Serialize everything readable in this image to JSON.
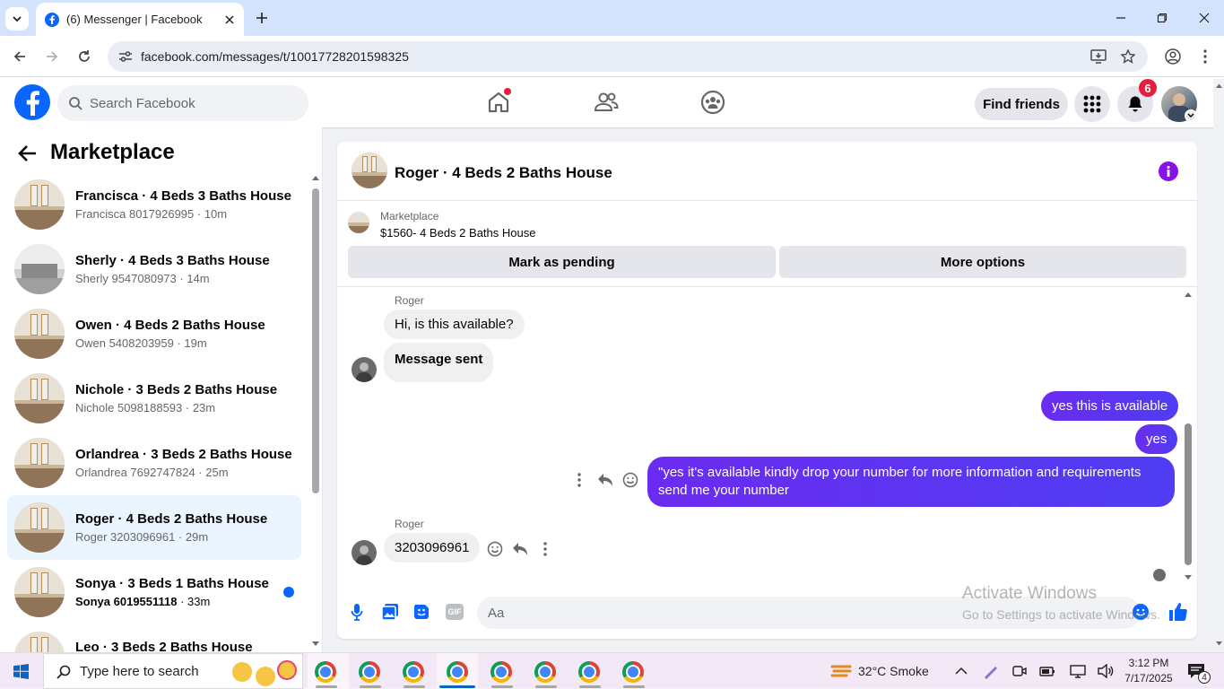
{
  "browser": {
    "tab_title": "(6) Messenger | Facebook",
    "url": "facebook.com/messages/t/10017728201598325"
  },
  "header": {
    "search_placeholder": "Search Facebook",
    "find_friends": "Find friends",
    "notification_count": "6",
    "brand_color": "#0866ff"
  },
  "left_panel": {
    "title": "Marketplace",
    "conversations": [
      {
        "name": "Francisca · 4 Beds 3 Baths House",
        "sub": "Francisca 8017926995 · 10m",
        "active": false,
        "unread": false
      },
      {
        "name": "Sherly · 4 Beds 3 Baths House",
        "sub": "Sherly 9547080973 · 14m",
        "active": false,
        "unread": false
      },
      {
        "name": "Owen · 4 Beds 2 Baths House",
        "sub": "Owen 5408203959 · 19m",
        "active": false,
        "unread": false
      },
      {
        "name": "Nichole · 3 Beds 2 Baths House",
        "sub": "Nichole 5098188593 · 23m",
        "active": false,
        "unread": false
      },
      {
        "name": "Orlandrea · 3 Beds 2 Baths House",
        "sub": "Orlandrea 7692747824 · 25m",
        "active": false,
        "unread": false
      },
      {
        "name": "Roger · 4 Beds 2 Baths House",
        "sub": "Roger 3203096961 · 29m",
        "active": true,
        "unread": false
      },
      {
        "name": "Sonya · 3 Beds 1 Baths House",
        "sub_bold": "Sonya 6019551118",
        "sub_time": " · 33m",
        "active": false,
        "unread": true
      },
      {
        "name": "Leo · 3 Beds 2 Baths House",
        "sub": "",
        "active": false,
        "unread": false
      }
    ]
  },
  "chat": {
    "title": "Roger · 4 Beds 2 Baths House",
    "listing_source": "Marketplace",
    "listing_price": "$1560- 4 Beds 2 Baths House",
    "mark_pending": "Mark as pending",
    "more_options": "More options",
    "messages": {
      "sender1": "Roger",
      "in1": "Hi, is this available?",
      "in2": "Message sent",
      "out1": "yes this is available",
      "out2": "yes",
      "out3": "\"yes it's available kindly drop your number for more information and requirements send me your number",
      "sender2": "Roger",
      "in3": "3203096961"
    },
    "composer_placeholder": "Aa",
    "bubble_color": "#6b2bf0"
  },
  "watermark": {
    "line1": "Activate Windows",
    "line2": "Go to Settings to activate Windows."
  },
  "taskbar": {
    "search_placeholder": "Type here to search",
    "weather": "32°C  Smoke",
    "time": "3:12 PM",
    "date": "7/17/2025",
    "notif_count": "4"
  }
}
